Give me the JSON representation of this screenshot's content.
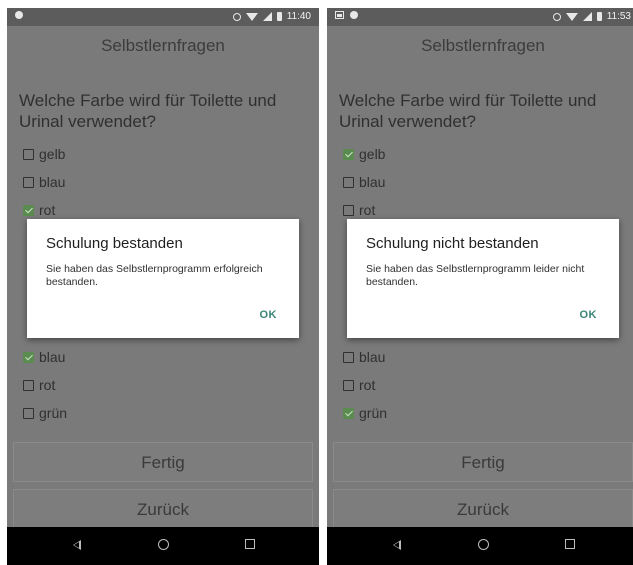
{
  "screens": [
    {
      "status": {
        "time": "11:40"
      },
      "title": "Selbstlernfragen",
      "q1": {
        "text": "Welche Farbe wird für Toilette und Urinal verwendet?",
        "options": [
          {
            "label": "gelb",
            "checked": false
          },
          {
            "label": "blau",
            "checked": false
          },
          {
            "label": "rot",
            "checked": true
          }
        ]
      },
      "q2": {
        "options": [
          {
            "label": "blau",
            "checked": true
          },
          {
            "label": "rot",
            "checked": false
          },
          {
            "label": "grün",
            "checked": false
          }
        ]
      },
      "buttons": {
        "done": "Fertig",
        "back": "Zurück"
      },
      "dialog": {
        "title": "Schulung bestanden",
        "message": "Sie haben das Selbstlernprogramm erfolgreich bestanden.",
        "ok": "OK"
      }
    },
    {
      "status": {
        "time": "11:53"
      },
      "title": "Selbstlernfragen",
      "q1": {
        "text": "Welche Farbe wird für Toilette und Urinal verwendet?",
        "options": [
          {
            "label": "gelb",
            "checked": true
          },
          {
            "label": "blau",
            "checked": false
          },
          {
            "label": "rot",
            "checked": false
          }
        ]
      },
      "q2": {
        "options": [
          {
            "label": "blau",
            "checked": false
          },
          {
            "label": "rot",
            "checked": false
          },
          {
            "label": "grün",
            "checked": true
          }
        ]
      },
      "buttons": {
        "done": "Fertig",
        "back": "Zurück"
      },
      "dialog": {
        "title": "Schulung nicht bestanden",
        "message": "Sie haben das Selbstlernprogramm leider nicht bestanden.",
        "ok": "OK"
      }
    }
  ],
  "colors": {
    "checkbox_checked": "#5a8b4f",
    "dialog_accent": "#3a8478",
    "scrim_background": "#7a7a7a"
  }
}
